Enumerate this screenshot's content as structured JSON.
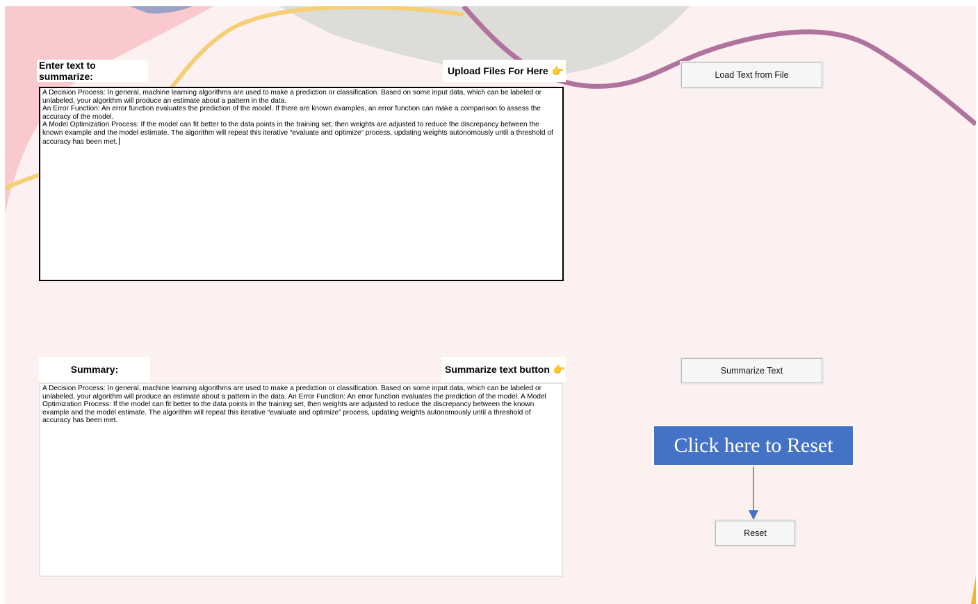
{
  "input_section": {
    "label": "Enter text to summarize:",
    "upload_hint": "Upload Files For Here",
    "text_lines": [
      "A Decision Process: In general, machine learning algorithms are used to make a prediction or classification. Based on some input data, which can be labeled or unlabeled, your algorithm will produce an estimate about a pattern in the data.",
      "An Error Function: An error function evaluates the prediction of the model. If there are known examples, an error function can make a comparison to assess the accuracy of the model.",
      "A Model Optimization Process: If the model can fit better to the data points in the training set, then weights are adjusted to reduce the discrepancy between the known example and the model estimate. The algorithm will repeat this iterative “evaluate and optimize” process, updating weights autonomously until a threshold of accuracy has been met."
    ]
  },
  "summary_section": {
    "label": "Summary:",
    "summarize_hint": "Summarize text button",
    "text": "A Decision Process: In general, machine learning algorithms are used to make a prediction or classification. Based on some input data, which can be labeled or unlabeled, your algorithm will produce an estimate about a pattern in the data. An Error Function: An error function evaluates the prediction of the model. A Model Optimization Process: If the model can fit better to the data points in the training set, then weights are adjusted to reduce the discrepancy between the known example and the model estimate. The algorithm will repeat this iterative “evaluate and optimize” process, updating weights autonomously until a threshold of accuracy has been met."
  },
  "buttons": {
    "load_file": "Load Text from File",
    "summarize": "Summarize Text",
    "reset": "Reset"
  },
  "callout": {
    "text": "Click here to Reset"
  },
  "icons": {
    "pointer": "backhand-index-pointing-right-icon"
  },
  "colors": {
    "background": "#fdf0f1",
    "callout": "#4472c4",
    "pointer": "#f1b52a"
  }
}
